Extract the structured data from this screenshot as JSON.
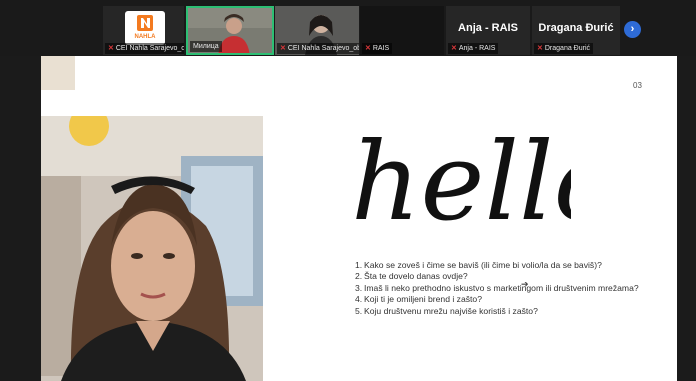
{
  "participants": [
    {
      "id": "p1",
      "name": "CEI Nahla Sarajevo_obuke",
      "logo_text": "NAHLA",
      "muted": true
    },
    {
      "id": "p2",
      "name": "Милица",
      "muted": false,
      "active": true
    },
    {
      "id": "p3",
      "name": "CEI Nahla Sarajevo_obuke",
      "muted": true
    },
    {
      "id": "p4",
      "name": "RAIS",
      "muted": true
    },
    {
      "id": "p5",
      "name": "Anja - RAIS",
      "display": "Anja - RAIS",
      "muted": true
    },
    {
      "id": "p6",
      "name": "Dragana Đurić",
      "display": "Dragana Đurić",
      "muted": true
    }
  ],
  "strip": {
    "next_icon": "chevron-right-icon",
    "accent": "#2e6bd6",
    "active_border": "#2dbf74"
  },
  "slide": {
    "page_number": "03",
    "hello_text": "hello",
    "questions": [
      {
        "num": "1.",
        "text": "Kako se zoveš i čime se baviš (ili čime bi volio/la da se baviš)?"
      },
      {
        "num": "2.",
        "text": "Šta te dovelo danas ovdje?"
      },
      {
        "num": "3.",
        "text": "Imaš li neko prethodno iskustvo s marketingom ili društvenim mrežama?"
      },
      {
        "num": "4.",
        "text": "Koji ti je omiljeni brend  i zašto?"
      },
      {
        "num": "5.",
        "text": "Koju društvenu mrežu najviše koristiš i zašto?"
      }
    ]
  }
}
